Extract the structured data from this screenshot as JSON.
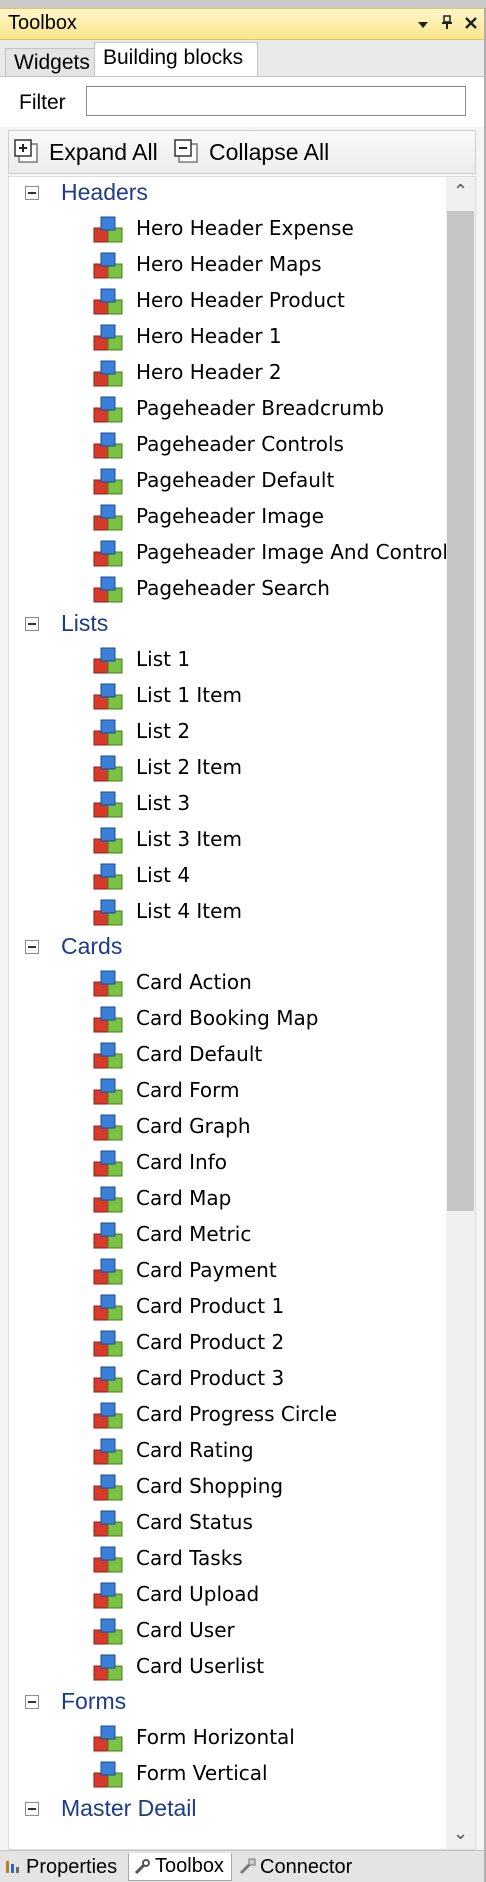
{
  "window": {
    "title": "Toolbox",
    "pin_icon": "pin-icon",
    "close_icon": "close-icon",
    "dropdown_icon": "dropdown-arrow-icon"
  },
  "tabs": [
    "Widgets",
    "Building blocks"
  ],
  "active_tab": "Building blocks",
  "filter": {
    "label": "Filter",
    "value": "",
    "placeholder": ""
  },
  "toolbar": {
    "expand_all": "Expand All",
    "collapse_all": "Collapse All"
  },
  "tree": {
    "groups": [
      {
        "name": "Headers",
        "items": [
          "Hero Header Expense",
          "Hero Header Maps",
          "Hero Header Product",
          "Hero Header 1",
          "Hero Header 2",
          "Pageheader Breadcrumb",
          "Pageheader Controls",
          "Pageheader Default",
          "Pageheader Image",
          "Pageheader Image And Controls",
          "Pageheader Search"
        ]
      },
      {
        "name": "Lists",
        "items": [
          "List 1",
          "List 1 Item",
          "List 2",
          "List 2 Item",
          "List 3",
          "List 3 Item",
          "List 4",
          "List 4 Item"
        ]
      },
      {
        "name": "Cards",
        "items": [
          "Card Action",
          "Card Booking Map",
          "Card Default",
          "Card Form",
          "Card Graph",
          "Card Info",
          "Card Map",
          "Card Metric",
          "Card Payment",
          "Card Product 1",
          "Card Product 2",
          "Card Product 3",
          "Card Progress Circle",
          "Card Rating",
          "Card Shopping",
          "Card Status",
          "Card Tasks",
          "Card Upload",
          "Card User",
          "Card Userlist"
        ]
      },
      {
        "name": "Forms",
        "items": [
          "Form Horizontal",
          "Form Vertical"
        ]
      },
      {
        "name": "Master Detail",
        "items": []
      }
    ]
  },
  "bottom_tabs": [
    "Properties",
    "Toolbox",
    "Connector"
  ],
  "active_bottom_tab": "Toolbox",
  "colors": {
    "group_label": "#1c3c8a",
    "title_bar": "#f9e68a"
  }
}
